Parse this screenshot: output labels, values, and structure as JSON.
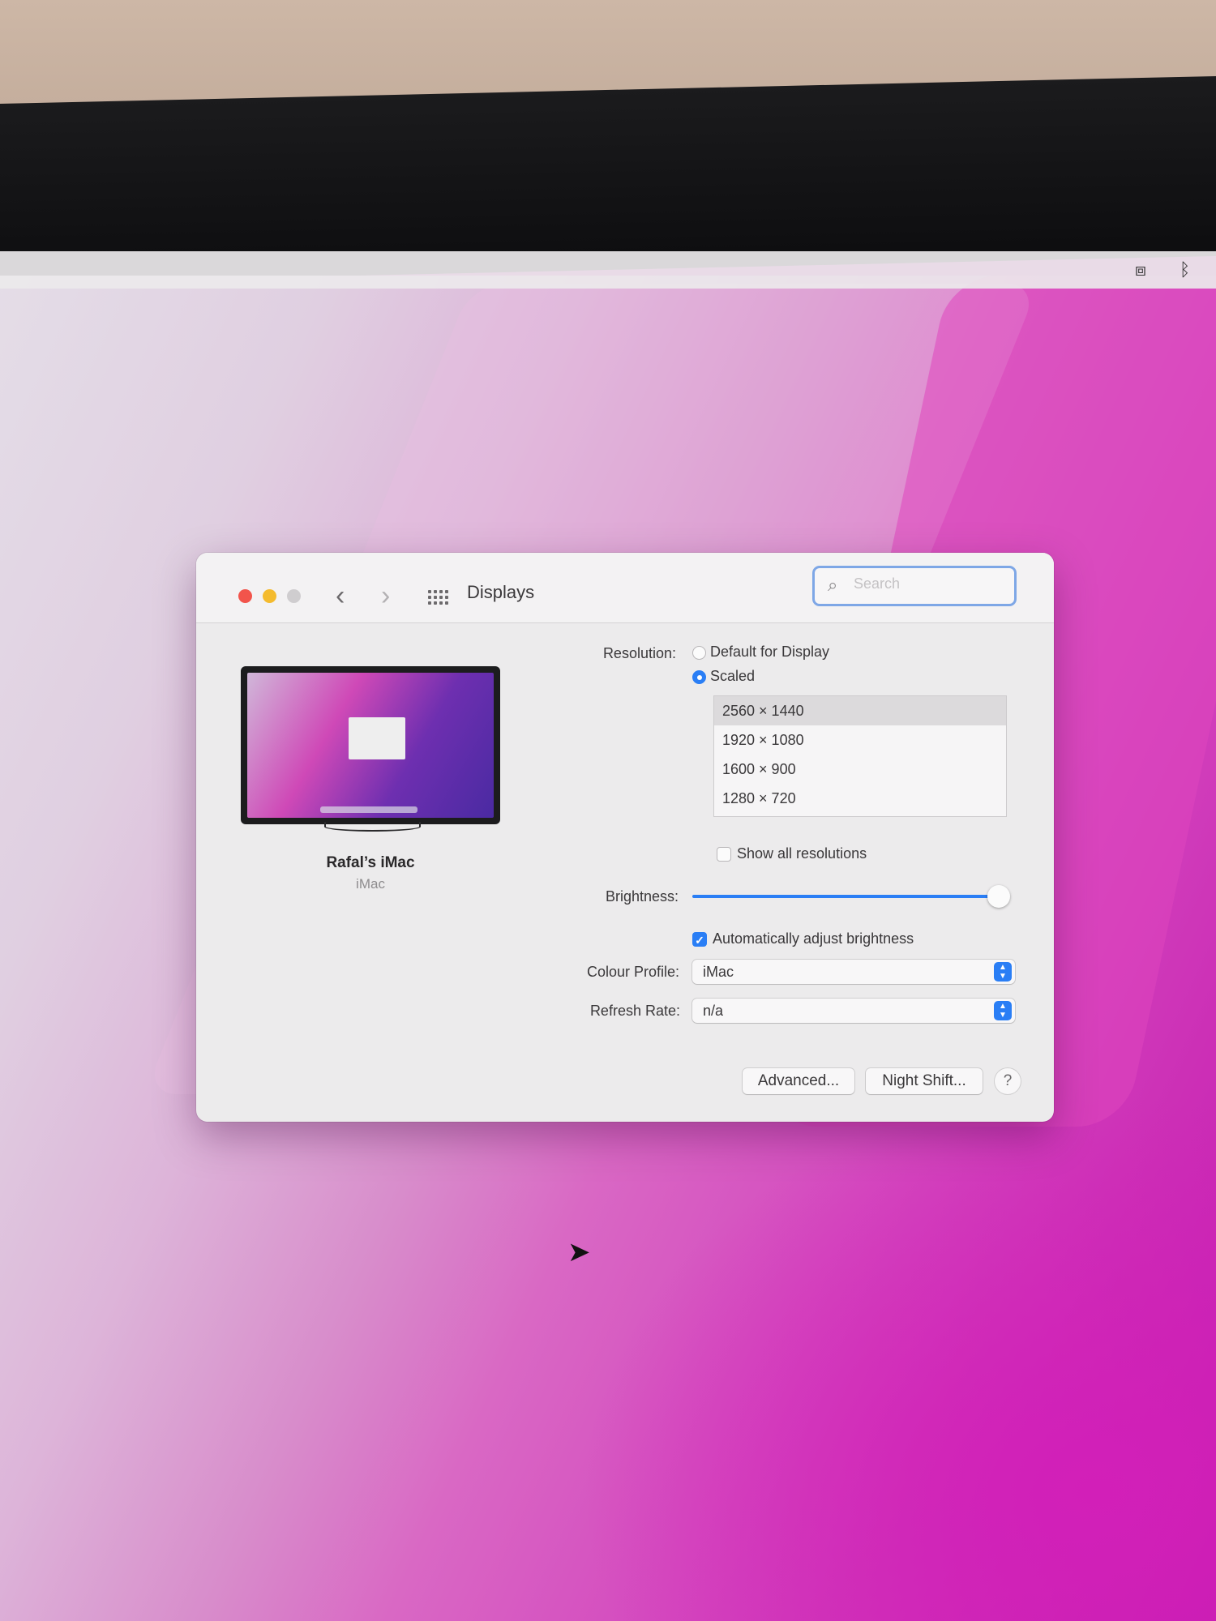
{
  "window": {
    "title": "Displays",
    "search_placeholder": "Search"
  },
  "display": {
    "name": "Rafal’s iMac",
    "model": "iMac"
  },
  "resolution": {
    "label": "Resolution:",
    "option_default": "Default for Display",
    "option_scaled": "Scaled",
    "selected_option": "Scaled",
    "list": [
      "2560 × 1440",
      "1920 × 1080",
      "1600 × 900",
      "1280 × 720"
    ],
    "selected_index": 0,
    "show_all_label": "Show all resolutions",
    "show_all_checked": false
  },
  "brightness": {
    "label": "Brightness:",
    "level": 0.97,
    "auto_label": "Automatically adjust brightness",
    "auto_checked": true
  },
  "colour_profile": {
    "label": "Colour Profile:",
    "value": "iMac"
  },
  "refresh_rate": {
    "label": "Refresh Rate:",
    "value": "n/a"
  },
  "buttons": {
    "advanced": "Advanced...",
    "night_shift": "Night Shift...",
    "help": "?"
  },
  "colors": {
    "accent": "#2a7ef5",
    "close": "#f2544b",
    "minimize": "#f4bb2e",
    "zoom_disabled": "#cfcdcf",
    "wallpaper": "#c63bb6"
  },
  "icons": {
    "back": "chevron-left-icon",
    "forward": "chevron-right-icon",
    "show_all": "grid-icon",
    "search": "search-icon",
    "menubar_1": "control-center-icon",
    "menubar_2": "bluetooth-icon"
  }
}
